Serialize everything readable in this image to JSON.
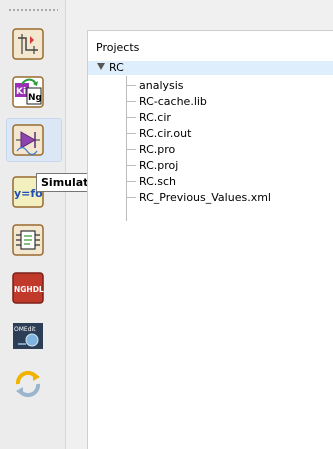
{
  "toolbar": {
    "tools": [
      {
        "icon": "kicad-schematic-icon"
      },
      {
        "icon": "kicad-to-ngspice-icon"
      },
      {
        "icon": "simulation-icon"
      },
      {
        "icon": "model-editor-icon"
      },
      {
        "icon": "subcircuit-icon"
      },
      {
        "icon": "nghdl-icon"
      },
      {
        "icon": "openmodelica-icon"
      },
      {
        "icon": "refresh-icon"
      }
    ],
    "yfor_text": "y=fo",
    "nghdl_text": "NGHDL",
    "om_text": "OMEdit"
  },
  "tooltip": {
    "text": "Simulation"
  },
  "project_tree": {
    "header": "Projects",
    "root": "RC",
    "children": [
      "analysis",
      "RC-cache.lib",
      "RC.cir",
      "RC.cir.out",
      "RC.pro",
      "RC.proj",
      "RC.sch",
      "RC_Previous_Values.xml"
    ]
  },
  "colors": {
    "selection": "#dfeefc",
    "tooltip_border": "#767676",
    "nghdl_bg": "#c0392b"
  }
}
